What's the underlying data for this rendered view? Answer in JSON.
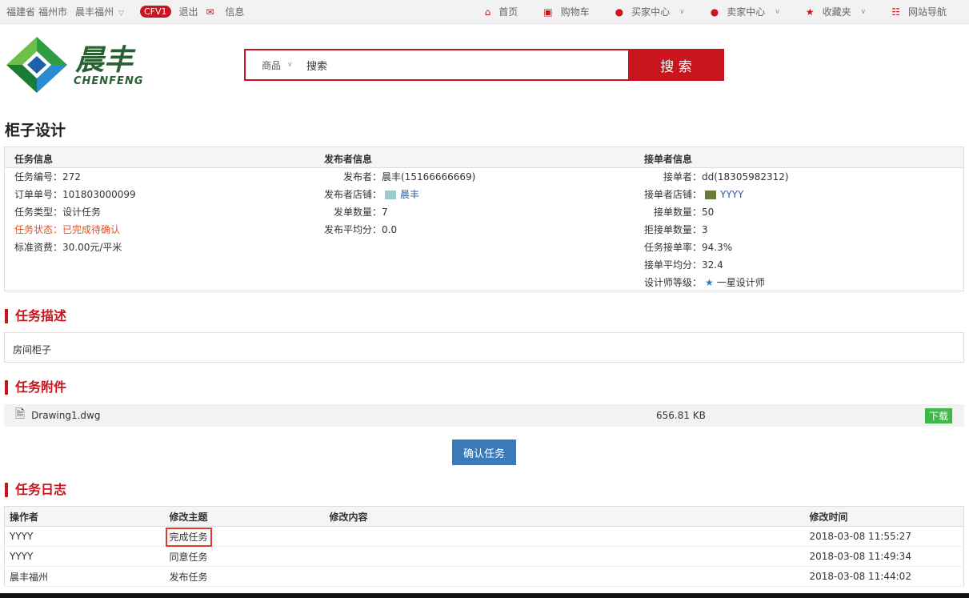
{
  "topbar": {
    "province": "福建省",
    "city": "福州市",
    "shop": "晨丰福州",
    "level": "CFV1",
    "logout": "退出",
    "messages": "信息",
    "nav": [
      "首页",
      "购物车",
      "买家中心",
      "卖家中心",
      "收藏夹",
      "网站导航"
    ]
  },
  "logo": {
    "cn": "晨丰",
    "en": "CHENFENG"
  },
  "search": {
    "category": "商品",
    "value": "搜索",
    "button": "搜 索"
  },
  "page_title": "柜子设计",
  "task_info": {
    "heading": "任务信息",
    "rows": [
      {
        "label": "任务编号：",
        "value": "272"
      },
      {
        "label": "订单单号：",
        "value": "101803000099"
      },
      {
        "label": "任务类型：",
        "value": "设计任务"
      },
      {
        "label": "任务状态：",
        "value": "已完成待确认"
      },
      {
        "label": "标准资费：",
        "value": "30.00元/平米"
      }
    ]
  },
  "publisher_info": {
    "heading": "发布者信息",
    "rows": [
      {
        "label": "发布者：",
        "value": "晨丰(15166666669)"
      },
      {
        "label": "发布者店铺：",
        "value": "晨丰"
      },
      {
        "label": "发单数量：",
        "value": "7"
      },
      {
        "label": "发布平均分：",
        "value": "0.0"
      }
    ]
  },
  "receiver_info": {
    "heading": "接单者信息",
    "rows": [
      {
        "label": "接单者：",
        "value": "dd(18305982312)"
      },
      {
        "label": "接单者店铺：",
        "value": "YYYY"
      },
      {
        "label": "接单数量：",
        "value": "50"
      },
      {
        "label": "拒接单数量：",
        "value": "3"
      },
      {
        "label": "任务接单率：",
        "value": "94.3%"
      },
      {
        "label": "接单平均分：",
        "value": "32.4"
      },
      {
        "label": "设计师等级：",
        "value": "一星设计师"
      }
    ]
  },
  "desc": {
    "heading": "任务描述",
    "text": "房间柜子"
  },
  "attachment": {
    "heading": "任务附件",
    "file": "Drawing1.dwg",
    "size": "656.81 KB",
    "download": "下载"
  },
  "confirm_button": "确认任务",
  "log": {
    "heading": "任务日志",
    "columns": [
      "操作者",
      "修改主题",
      "修改内容",
      "修改时间"
    ],
    "rows": [
      {
        "operator": "YYYY",
        "subject": "完成任务",
        "content": "",
        "time": "2018-03-08 11:55:27"
      },
      {
        "operator": "YYYY",
        "subject": "同意任务",
        "content": "",
        "time": "2018-03-08 11:49:34"
      },
      {
        "operator": "晨丰福州",
        "subject": "发布任务",
        "content": "",
        "time": "2018-03-08 11:44:02"
      }
    ]
  },
  "colors": {
    "brand_red": "#c9151e",
    "status_orange": "#e5501b",
    "confirm_blue": "#3a7ab8",
    "download_green": "#3db84b"
  }
}
